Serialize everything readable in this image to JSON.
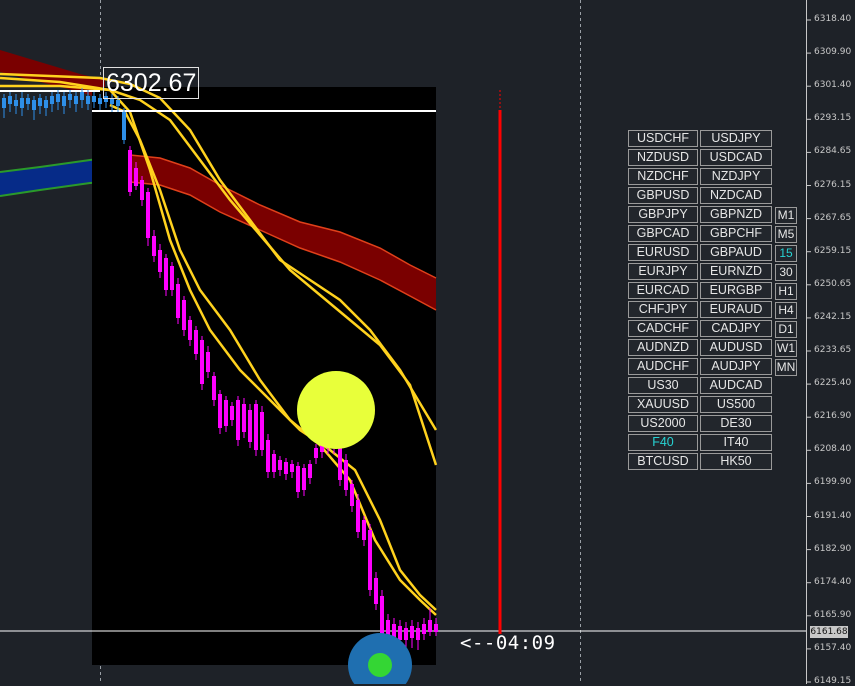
{
  "price_axis": {
    "ticks": [
      "6318.40",
      "6309.90",
      "6301.40",
      "6293.15",
      "6284.65",
      "6276.15",
      "6267.65",
      "6259.15",
      "6250.65",
      "6242.15",
      "6233.65",
      "6225.40",
      "6216.90",
      "6208.40",
      "6199.90",
      "6191.40",
      "6182.90",
      "6174.40",
      "6165.90",
      "6157.40",
      "6149.15"
    ],
    "current_price": "6161.68"
  },
  "price_label": "6302.67",
  "countdown": "<--04:09",
  "symbols": [
    [
      "USDCHF",
      "USDJPY"
    ],
    [
      "NZDUSD",
      "USDCAD"
    ],
    [
      "NZDCHF",
      "NZDJPY"
    ],
    [
      "GBPUSD",
      "NZDCAD"
    ],
    [
      "GBPJPY",
      "GBPNZD"
    ],
    [
      "GBPCAD",
      "GBPCHF"
    ],
    [
      "EURUSD",
      "GBPAUD"
    ],
    [
      "EURJPY",
      "EURNZD"
    ],
    [
      "EURCAD",
      "EURGBP"
    ],
    [
      "CHFJPY",
      "EURAUD"
    ],
    [
      "CADCHF",
      "CADJPY"
    ],
    [
      "AUDNZD",
      "AUDUSD"
    ],
    [
      "AUDCHF",
      "AUDJPY"
    ],
    [
      "US30",
      "AUDCAD"
    ],
    [
      "XAUUSD",
      "US500"
    ],
    [
      "US2000",
      "DE30"
    ],
    [
      "F40",
      "IT40"
    ],
    [
      "BTCUSD",
      "HK50"
    ]
  ],
  "highlighted_symbol": "F40",
  "timeframes": [
    "M1",
    "M5",
    "15",
    "30",
    "H1",
    "H4",
    "D1",
    "W1",
    "MN"
  ],
  "active_timeframe": "15",
  "colors": {
    "background": "#1e2228",
    "panel": "#000000",
    "bear_candle": "#ff00ff",
    "bull_candle": "#2e8fe8",
    "yellow_band": "#ffd21e",
    "red_band": "#7a0000",
    "blue_band": "#062b88",
    "timer_line": "#ff0000",
    "signal_circle": "#e8ff3a",
    "accent": "#27d3d3"
  }
}
